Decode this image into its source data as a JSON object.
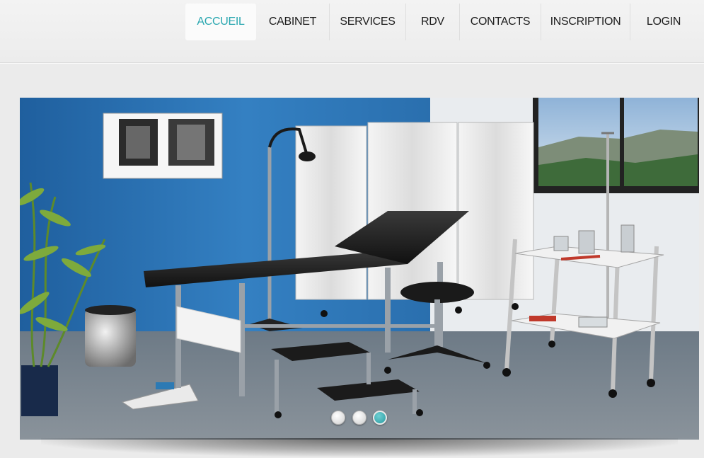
{
  "nav": {
    "items": [
      {
        "label": "ACCUEIL",
        "active": true
      },
      {
        "label": "CABINET",
        "active": false
      },
      {
        "label": "SERVICES",
        "active": false
      },
      {
        "label": "RDV",
        "active": false
      },
      {
        "label": "CONTACTS",
        "active": false
      },
      {
        "label": "INSCRIPTION",
        "active": false
      },
      {
        "label": "LOGIN",
        "active": false
      }
    ]
  },
  "slider": {
    "slide_count": 3,
    "active_slide": 3
  },
  "colors": {
    "accent": "#2aa7b0",
    "nav_text": "#1c1c1c",
    "page_background": "#ebebeb",
    "wall_blue": "#2f6fa9"
  }
}
